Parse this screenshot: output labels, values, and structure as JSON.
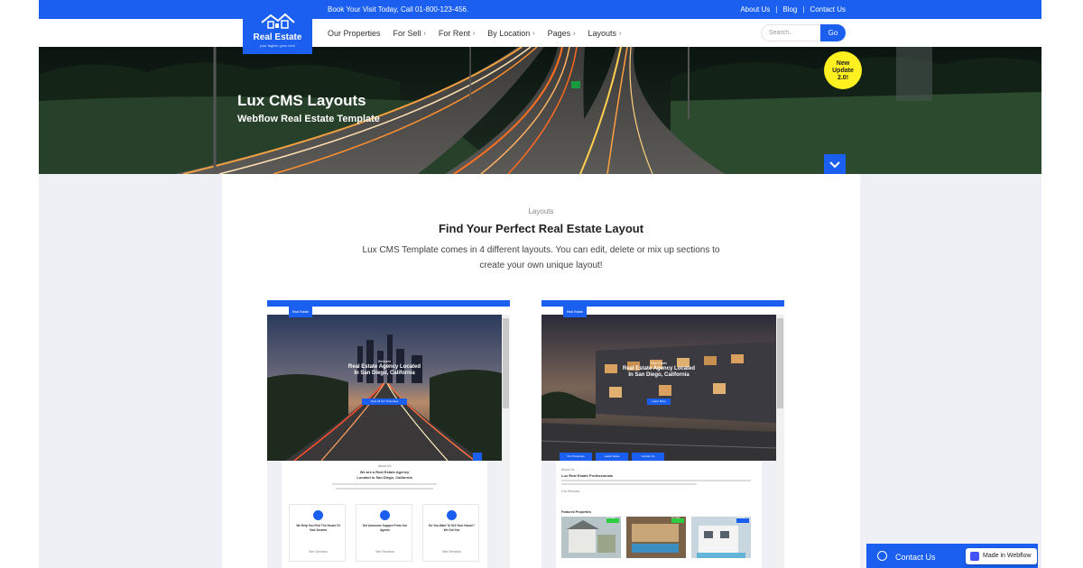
{
  "topbar": {
    "promo": "Book Your Visit Today, Call 01-800-123-456.",
    "links": [
      "About Us",
      "Blog",
      "Contact Us"
    ],
    "separator": "|"
  },
  "logo": {
    "text": "Real Estate",
    "tagline": "your tagline goes here"
  },
  "nav": {
    "items": [
      {
        "label": "Our Properties",
        "chevron": false
      },
      {
        "label": "For Sell",
        "chevron": true
      },
      {
        "label": "For Rent",
        "chevron": true
      },
      {
        "label": "By Location",
        "chevron": true
      },
      {
        "label": "Pages",
        "chevron": true
      },
      {
        "label": "Layouts",
        "chevron": true
      }
    ],
    "chevron_glyph": "›"
  },
  "search": {
    "placeholder": "Search..",
    "button": "Go"
  },
  "hero": {
    "title": "Lux CMS Layouts",
    "subtitle": "Webflow Real Estate Template",
    "badge_line1": "New",
    "badge_line2": "Update",
    "badge_line3": "2.0!",
    "scroll_icon": "chevron-down-icon"
  },
  "section": {
    "eyebrow": "Layouts",
    "heading": "Find Your Perfect Real Estate Layout",
    "description": "Lux CMS Template comes in 4 different layouts. You can edit, delete or mix up sections to create your own unique layout!"
  },
  "preview1": {
    "eyebrow": "Welcome",
    "title_line1": "Real Estate Agency Located",
    "title_line2": "In San Diego, California",
    "button": "View All Our Properties",
    "about_eyebrow": "About Us",
    "about_title_line1": "We are a Real Estate Agency",
    "about_title_line2": "Located in San Diego, California",
    "cards": [
      {
        "title_line1": "We Help You Find The House Of",
        "title_line2": "Your Dreams"
      },
      {
        "title_line1": "Get Awesome Support From Our",
        "title_line2": "Agents"
      },
      {
        "title_line1": "Do You Want To Sell Your House?",
        "title_line2": "We Got You"
      }
    ],
    "card_link": "See Services"
  },
  "preview2": {
    "eyebrow": "Real Estate",
    "title_line1": "Real Estate Agency Located",
    "title_line2": "In San Diego, California",
    "button": "Learn More",
    "tabs": [
      "Our Properties",
      "Latest News",
      "Contact Us"
    ],
    "about_eyebrow": "About Us",
    "about_title": "Lux Real Estate Professionals",
    "about_link": "Our Services",
    "featured": "Featured Properties",
    "featured_badge": "For Sale"
  },
  "widgets": {
    "contact": "Contact Us",
    "webflow": "Made in Webflow"
  },
  "colors": {
    "brand_blue": "#1a5ff0",
    "badge_yellow": "#fff020",
    "page_bg": "#eef0f6"
  }
}
